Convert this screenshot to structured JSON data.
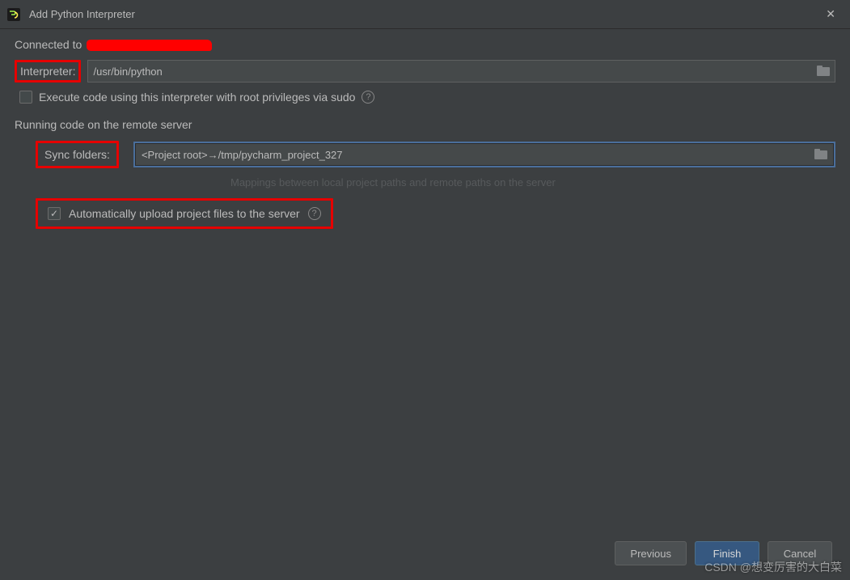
{
  "title": "Add Python Interpreter",
  "connected_prefix": "Connected to",
  "interpreter": {
    "label": "Interpreter:",
    "value": "/usr/bin/python"
  },
  "execute_root": {
    "label": "Execute code using this interpreter with root privileges via sudo",
    "checked": false
  },
  "remote_section_title": "Running code on the remote server",
  "sync_folders": {
    "label": "Sync folders:",
    "value": "<Project root>→/tmp/pycharm_project_327"
  },
  "mappings_hint": "Mappings between local project paths and remote paths on the server",
  "auto_upload": {
    "label": "Automatically upload project files to the server",
    "checked": true
  },
  "buttons": {
    "previous": "Previous",
    "finish": "Finish",
    "cancel": "Cancel"
  },
  "watermark": "CSDN @想变厉害的大白菜"
}
